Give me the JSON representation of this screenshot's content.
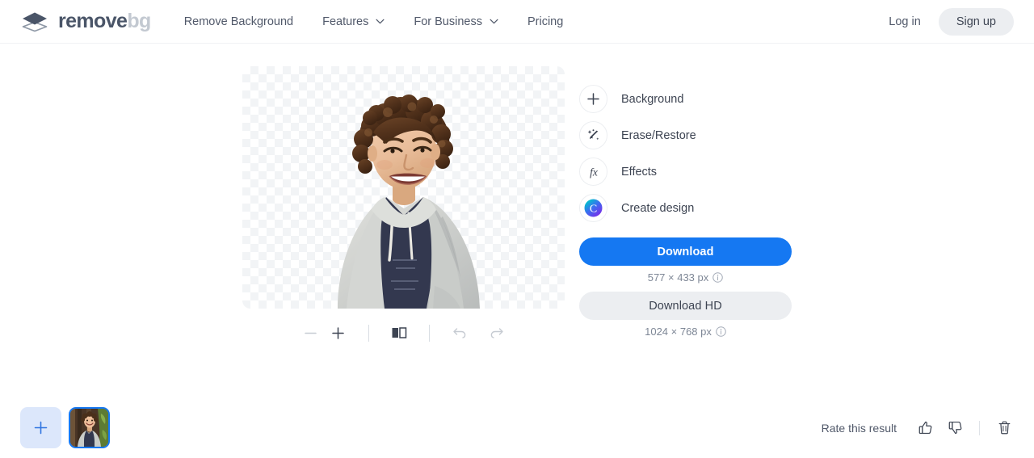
{
  "nav": {
    "logo": {
      "part1": "remove",
      "part2": "bg",
      "icon": "layers-icon"
    },
    "links": [
      {
        "label": "Remove Background",
        "has_chevron": false
      },
      {
        "label": "Features",
        "has_chevron": true
      },
      {
        "label": "For Business",
        "has_chevron": true
      },
      {
        "label": "Pricing",
        "has_chevron": false
      }
    ],
    "login_label": "Log in",
    "signup_label": "Sign up"
  },
  "editor": {
    "toolbar": [
      {
        "name": "zoom-out-icon",
        "label": "Zoom out",
        "disabled": true
      },
      {
        "name": "zoom-in-icon",
        "label": "Zoom in",
        "disabled": false
      },
      {
        "name": "compare-icon",
        "label": "Compare original",
        "disabled": false
      },
      {
        "name": "undo-icon",
        "label": "Undo",
        "disabled": true
      },
      {
        "name": "redo-icon",
        "label": "Redo",
        "disabled": true
      }
    ],
    "canvas_alt": "Cutout of smiling young man with curly brown hair wearing a gray hoodie on transparent checkerboard background"
  },
  "panel": {
    "options": [
      {
        "label": "Background",
        "icon": "plus-icon"
      },
      {
        "label": "Erase/Restore",
        "icon": "magic-brush-icon"
      },
      {
        "label": "Effects",
        "icon": "fx-icon"
      },
      {
        "label": "Create design",
        "icon": "canva-icon"
      }
    ],
    "download": {
      "label": "Download",
      "size": "577 × 433 px",
      "info_icon": "info-icon"
    },
    "download_hd": {
      "label": "Download HD",
      "size": "1024 × 768 px",
      "info_icon": "info-icon"
    }
  },
  "bottom": {
    "add_label": "+",
    "thumbnail_alt": "Original photo thumbnail of young man in front of wooden wall with green foliage",
    "rate_label": "Rate this result",
    "thumbs_up": "thumbs-up-icon",
    "thumbs_down": "thumbs-down-icon",
    "delete": "trash-icon"
  },
  "colors": {
    "accent_blue": "#1578f2",
    "nav_text": "#51596a",
    "button_gray": "#eceef1",
    "thumb_bg": "#dce7fb"
  }
}
